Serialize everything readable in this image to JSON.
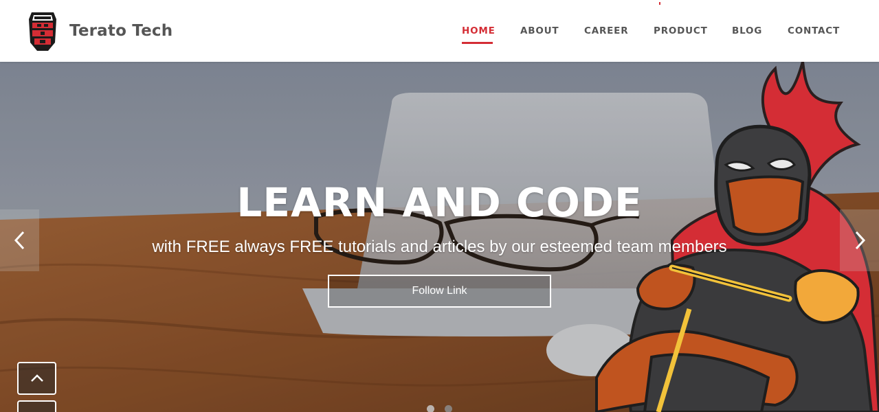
{
  "brand": {
    "name": "Terato Tech",
    "logo_icon": "knight-helmet-logo-icon"
  },
  "nav": {
    "items": [
      {
        "label": "HOME",
        "active": true
      },
      {
        "label": "ABOUT",
        "active": false
      },
      {
        "label": "CAREER",
        "active": false
      },
      {
        "label": "PRODUCT",
        "active": false
      },
      {
        "label": "BLOG",
        "active": false
      },
      {
        "label": "CONTACT",
        "active": false
      }
    ]
  },
  "hero": {
    "headline": "LEARN AND CODE",
    "subheadline": "with FREE always FREE tutorials and articles by our esteemed team members",
    "cta_label": "Follow Link",
    "prev_icon": "chevron-left-icon",
    "next_icon": "chevron-right-icon",
    "slide_count": 2,
    "active_slide": 1
  },
  "scroll_top_icon": "chevron-up-icon",
  "colors": {
    "accent": "#d42d35",
    "text": "#555555",
    "header_bg": "#ffffff"
  }
}
